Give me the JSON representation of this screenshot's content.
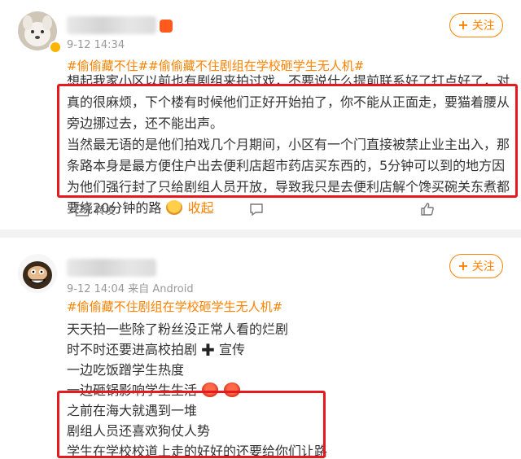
{
  "post1": {
    "meta": "9-12 14:34",
    "follow_label": "关注",
    "hashtag": "#偷偷藏不住##偷偷藏不住剧组在学校砸学生无人机#",
    "body_cut": "想起我家小区以前也有剧组来拍过戏，不要说什么提前联系好了打点好了，对住户来说",
    "body_p1": "真的很麻烦，下个楼有时候他们正好开始拍了，你不能从正面走，要猫着腰从旁边挪过去，还不能出声。",
    "body_p2": "当然最无语的是他们拍戏几个月期间，小区有一个门直接被禁止业主出入，那条路本身是最方便住户出去便利店超市药店买东西的，5分钟可以到的地方因为他们强行封了只给剧组人员开放，导致我只是去便利店解个馋买碗关东煮都要绕20分钟的路",
    "collapse_label": "收起",
    "actions": {
      "forward_label": "转发"
    },
    "icons": [
      "verified-badge-icon",
      "vip-badge-icon",
      "share-icon",
      "comment-icon",
      "like-icon",
      "emoji-crying-icon"
    ]
  },
  "post2": {
    "meta": "9-12 14:04  来自 Android",
    "follow_label": "关注",
    "hashtag": "#偷偷藏不住剧组在学校砸学生无人机#",
    "lines": [
      "天天拍一些除了粉丝没正常人看的烂剧",
      "时不时还要进高校拍剧",
      "宣传",
      "一边吃饭蹭学生热度",
      "一边砸锅影响学生生活",
      "之前在海大就遇到一堆",
      "剧组人员还喜欢狗仗人势",
      "学生在学校校道上走的好好的还要给你们让路"
    ],
    "icons": [
      "cartoon-avatar-icon",
      "emoji-angry-icon",
      "plus-cross-icon"
    ]
  },
  "colors": {
    "accent": "#ff8200",
    "highlight_box": "#e8191e",
    "text": "#333333",
    "meta": "#999999",
    "divider": "#f2f2f2"
  }
}
